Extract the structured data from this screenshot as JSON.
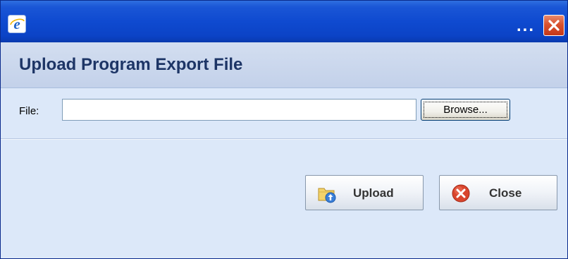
{
  "window": {
    "title_overflow": "...",
    "icons": {
      "app": "internet-explorer-icon",
      "close": "close-x-icon"
    }
  },
  "header": {
    "title": "Upload Program Export File"
  },
  "file_row": {
    "label": "File:",
    "value": "",
    "browse_label": "Browse..."
  },
  "actions": {
    "upload_label": "Upload",
    "upload_icon": "folder-upload-icon",
    "close_label": "Close",
    "close_icon": "red-x-circle-icon"
  },
  "colors": {
    "titlebar": "#0b43c6",
    "header_text": "#1d3566",
    "panel_background": "#dce8f9",
    "close_button": "#d9522e"
  }
}
